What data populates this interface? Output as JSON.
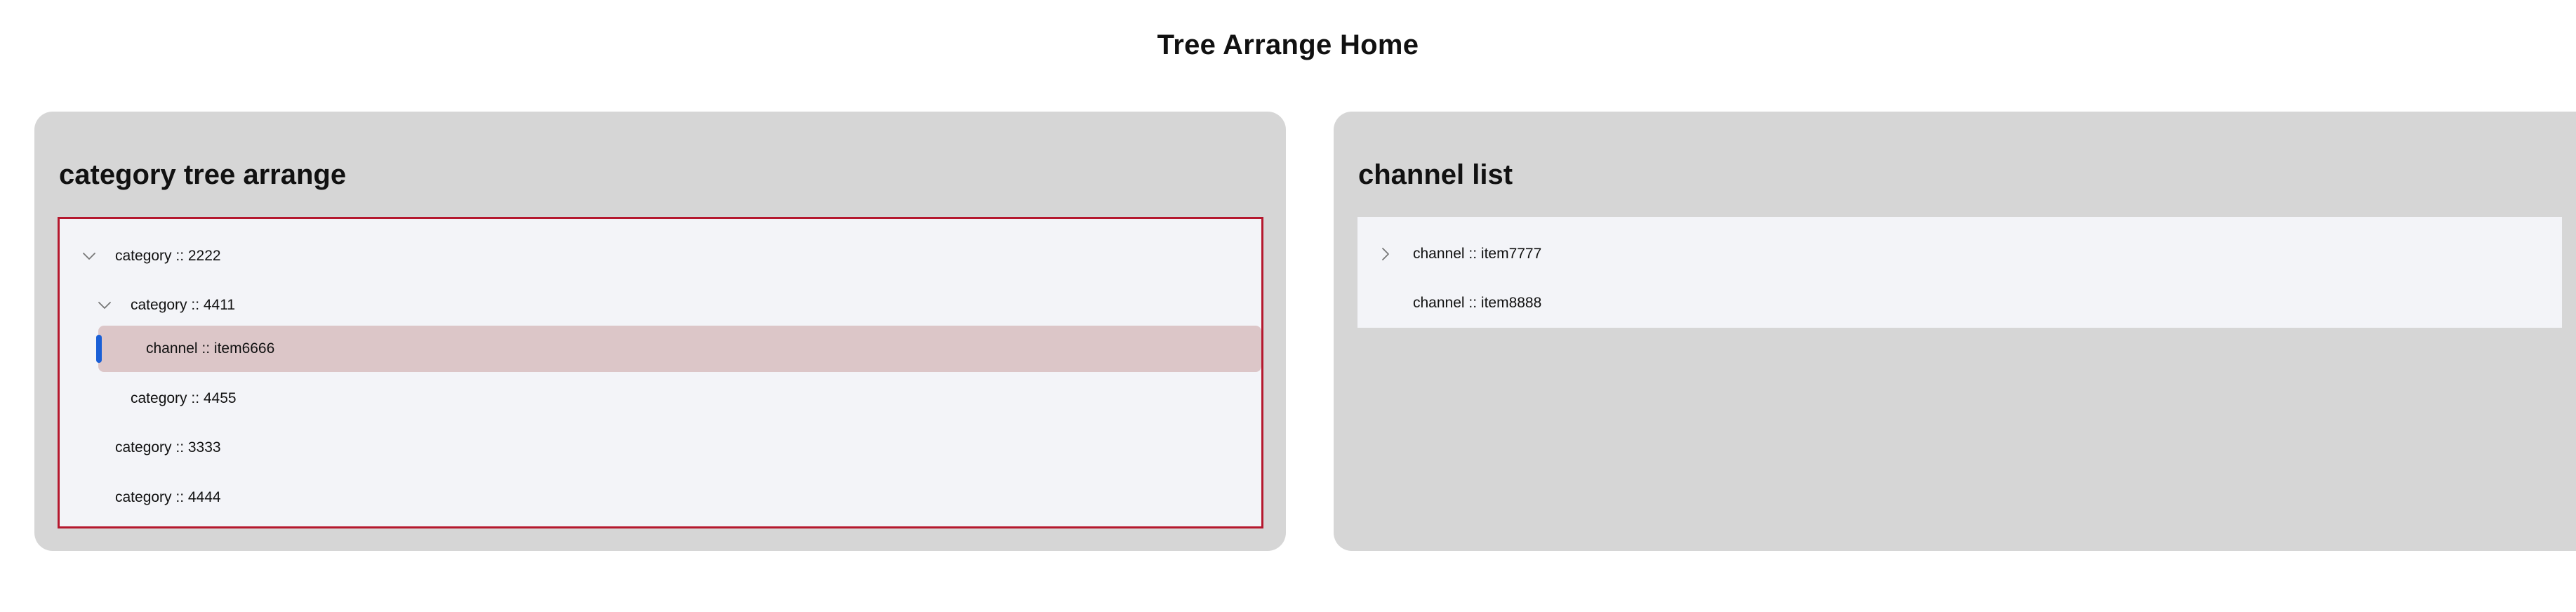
{
  "page": {
    "title": "Tree Arrange Home"
  },
  "category_panel": {
    "title": "category tree arrange",
    "items": [
      {
        "label": "category :: 2222",
        "level": 0,
        "expanded": true,
        "selected": false
      },
      {
        "label": "category :: 4411",
        "level": 1,
        "expanded": true,
        "selected": false
      },
      {
        "label": "channel :: item6666",
        "level": 2,
        "expanded": false,
        "selected": true
      },
      {
        "label": "category :: 4455",
        "level": 1,
        "expanded": false,
        "selected": false
      },
      {
        "label": "category :: 3333",
        "level": 0,
        "expanded": false,
        "selected": false
      },
      {
        "label": "category :: 4444",
        "level": 0,
        "expanded": false,
        "selected": false
      }
    ]
  },
  "channel_panel": {
    "title": "channel list",
    "items": [
      {
        "label": "channel :: item7777",
        "expandable": true
      },
      {
        "label": "channel :: item8888",
        "expandable": false
      }
    ]
  },
  "colors": {
    "panel_bg": "#d6d6d6",
    "tree_bg": "#f3f4f8",
    "focus_border": "#b5182e",
    "selected_bg": "#dcc6c8",
    "selected_indicator": "#1a5fd6"
  },
  "icons": {
    "expanded": "chevron-down-icon",
    "collapsed": "chevron-right-icon"
  }
}
